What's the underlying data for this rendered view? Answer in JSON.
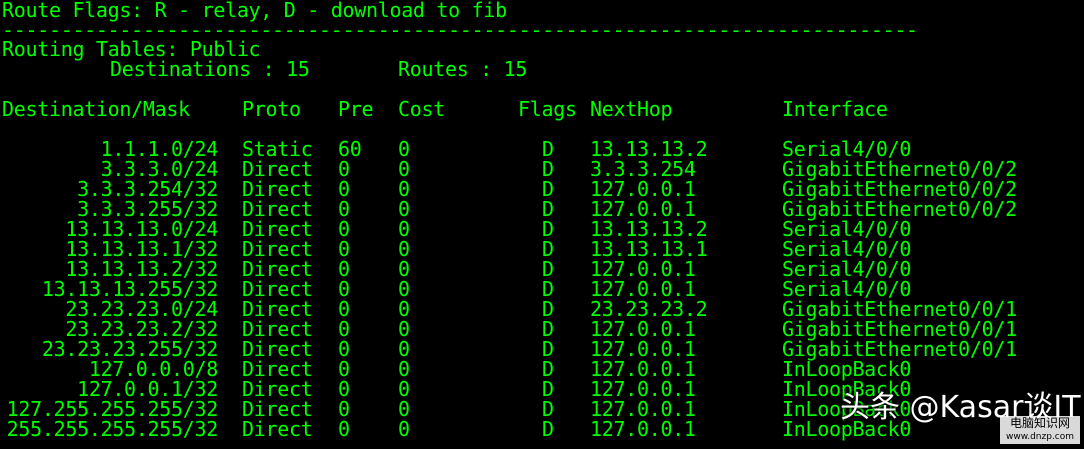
{
  "terminal": {
    "flags_line": "Route Flags: R - relay, D - download to fib",
    "separator": "------------------------------------------------------------------------------",
    "table_title": "Routing Tables: Public",
    "destinations_label": "Destinations : 15",
    "routes_label": "Routes : 15",
    "headers": {
      "destination": "Destination/Mask",
      "proto": "Proto",
      "pre": "Pre",
      "cost": "Cost",
      "flags": "Flags",
      "nexthop": "NextHop",
      "interface": "Interface"
    },
    "rows": [
      {
        "destination": "1.1.1.0/24",
        "proto": "Static",
        "pre": "60",
        "cost": "0",
        "flags": "D",
        "nexthop": "13.13.13.2",
        "interface": "Serial4/0/0"
      },
      {
        "destination": "3.3.3.0/24",
        "proto": "Direct",
        "pre": "0",
        "cost": "0",
        "flags": "D",
        "nexthop": "3.3.3.254",
        "interface": "GigabitEthernet0/0/2"
      },
      {
        "destination": "3.3.3.254/32",
        "proto": "Direct",
        "pre": "0",
        "cost": "0",
        "flags": "D",
        "nexthop": "127.0.0.1",
        "interface": "GigabitEthernet0/0/2"
      },
      {
        "destination": "3.3.3.255/32",
        "proto": "Direct",
        "pre": "0",
        "cost": "0",
        "flags": "D",
        "nexthop": "127.0.0.1",
        "interface": "GigabitEthernet0/0/2"
      },
      {
        "destination": "13.13.13.0/24",
        "proto": "Direct",
        "pre": "0",
        "cost": "0",
        "flags": "D",
        "nexthop": "13.13.13.2",
        "interface": "Serial4/0/0"
      },
      {
        "destination": "13.13.13.1/32",
        "proto": "Direct",
        "pre": "0",
        "cost": "0",
        "flags": "D",
        "nexthop": "13.13.13.1",
        "interface": "Serial4/0/0"
      },
      {
        "destination": "13.13.13.2/32",
        "proto": "Direct",
        "pre": "0",
        "cost": "0",
        "flags": "D",
        "nexthop": "127.0.0.1",
        "interface": "Serial4/0/0"
      },
      {
        "destination": "13.13.13.255/32",
        "proto": "Direct",
        "pre": "0",
        "cost": "0",
        "flags": "D",
        "nexthop": "127.0.0.1",
        "interface": "Serial4/0/0"
      },
      {
        "destination": "23.23.23.0/24",
        "proto": "Direct",
        "pre": "0",
        "cost": "0",
        "flags": "D",
        "nexthop": "23.23.23.2",
        "interface": "GigabitEthernet0/0/1"
      },
      {
        "destination": "23.23.23.2/32",
        "proto": "Direct",
        "pre": "0",
        "cost": "0",
        "flags": "D",
        "nexthop": "127.0.0.1",
        "interface": "GigabitEthernet0/0/1"
      },
      {
        "destination": "23.23.23.255/32",
        "proto": "Direct",
        "pre": "0",
        "cost": "0",
        "flags": "D",
        "nexthop": "127.0.0.1",
        "interface": "GigabitEthernet0/0/1"
      },
      {
        "destination": "127.0.0.0/8",
        "proto": "Direct",
        "pre": "0",
        "cost": "0",
        "flags": "D",
        "nexthop": "127.0.0.1",
        "interface": "InLoopBack0"
      },
      {
        "destination": "127.0.0.1/32",
        "proto": "Direct",
        "pre": "0",
        "cost": "0",
        "flags": "D",
        "nexthop": "127.0.0.1",
        "interface": "InLoopBack0"
      },
      {
        "destination": "127.255.255.255/32",
        "proto": "Direct",
        "pre": "0",
        "cost": "0",
        "flags": "D",
        "nexthop": "127.0.0.1",
        "interface": "InLoopBack0"
      },
      {
        "destination": "255.255.255.255/32",
        "proto": "Direct",
        "pre": "0",
        "cost": "0",
        "flags": "D",
        "nexthop": "127.0.0.1",
        "interface": "InLoopBack0"
      }
    ]
  },
  "watermark": {
    "text": "头条 @Kasar谈IT",
    "site_name": "电脑知识网",
    "site_url": "www.dnzp.com"
  },
  "colors": {
    "background": "#000000",
    "foreground": "#00ff00"
  }
}
